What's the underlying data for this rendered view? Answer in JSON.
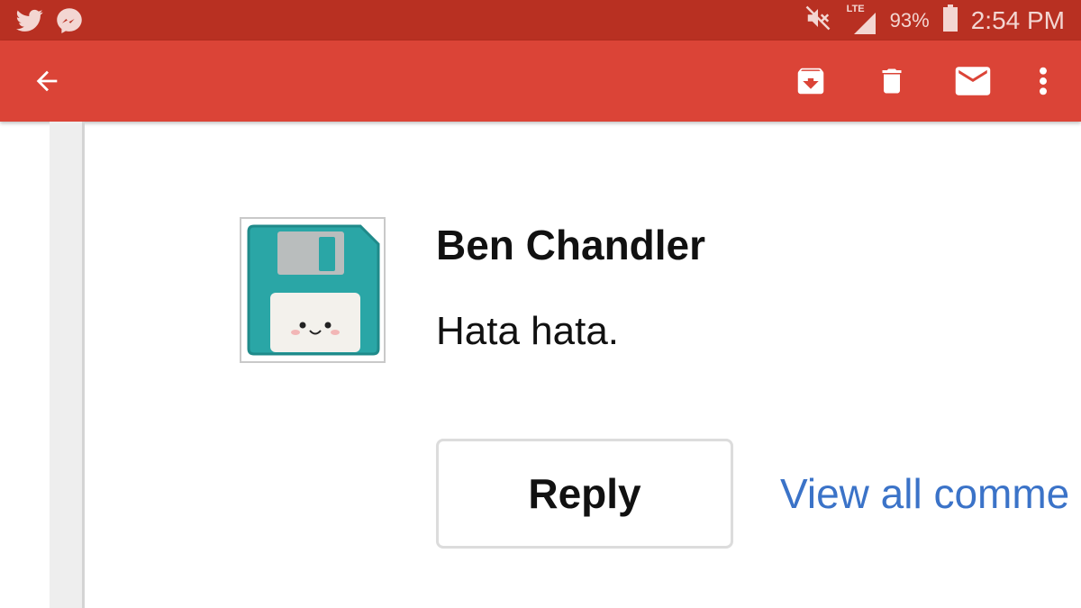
{
  "status_bar": {
    "battery": "93%",
    "time": "2:54 PM",
    "network": "LTE",
    "icons": [
      "twitter-icon",
      "messenger-icon",
      "mute-icon",
      "signal-icon",
      "battery-icon"
    ]
  },
  "toolbar": {
    "icons": [
      "back-arrow-icon",
      "archive-icon",
      "delete-icon",
      "mail-icon",
      "more-vert-icon"
    ]
  },
  "comment": {
    "author": "Ben Chandler",
    "text": "Hata hata.",
    "avatar": "floppy-disk-plush-avatar"
  },
  "actions": {
    "reply_label": "Reply",
    "view_all_label": "View all comme"
  },
  "colors": {
    "status_bar": "#b83022",
    "toolbar": "#db4437",
    "link": "#3b73c8",
    "avatar_teal": "#2aa6a6"
  }
}
